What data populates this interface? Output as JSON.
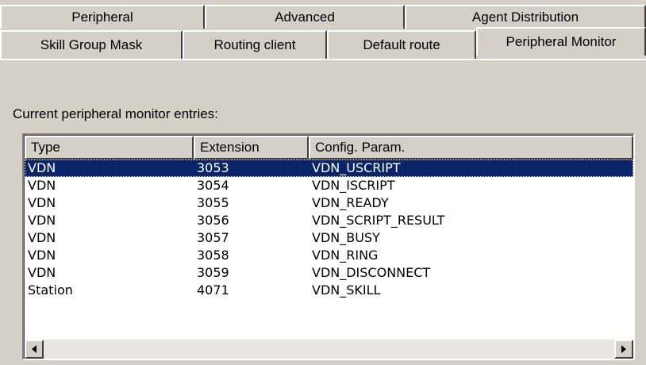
{
  "tabs_back": [
    {
      "label": "Peripheral",
      "name": "tab-peripheral",
      "width": 258
    },
    {
      "label": "Advanced",
      "name": "tab-advanced",
      "width": 252
    },
    {
      "label": "Agent Distribution",
      "name": "tab-agent-distribution",
      "width": 304
    }
  ],
  "tabs_front": [
    {
      "label": "Skill Group Mask",
      "name": "tab-skill-group-mask"
    },
    {
      "label": "Routing client",
      "name": "tab-routing-client"
    },
    {
      "label": "Default route",
      "name": "tab-default-route"
    },
    {
      "label": "Peripheral Monitor",
      "name": "tab-peripheral-monitor",
      "selected": true
    }
  ],
  "caption": "Current peripheral monitor entries:",
  "columns": {
    "type": "Type",
    "extension": "Extension",
    "config": "Config. Param."
  },
  "rows": [
    {
      "type": "VDN",
      "extension": "3053",
      "config": "VDN_USCRIPT",
      "selected": true
    },
    {
      "type": "VDN",
      "extension": "3054",
      "config": "VDN_ISCRIPT"
    },
    {
      "type": "VDN",
      "extension": "3055",
      "config": "VDN_READY"
    },
    {
      "type": "VDN",
      "extension": "3056",
      "config": "VDN_SCRIPT_RESULT"
    },
    {
      "type": "VDN",
      "extension": "3057",
      "config": "VDN_BUSY"
    },
    {
      "type": "VDN",
      "extension": "3058",
      "config": "VDN_RING"
    },
    {
      "type": "VDN",
      "extension": "3059",
      "config": "VDN_DISCONNECT"
    },
    {
      "type": "Station",
      "extension": "4071",
      "config": "VDN_SKILL"
    }
  ],
  "colors": {
    "selection": "#0a246a",
    "face": "#d4d0c8"
  }
}
